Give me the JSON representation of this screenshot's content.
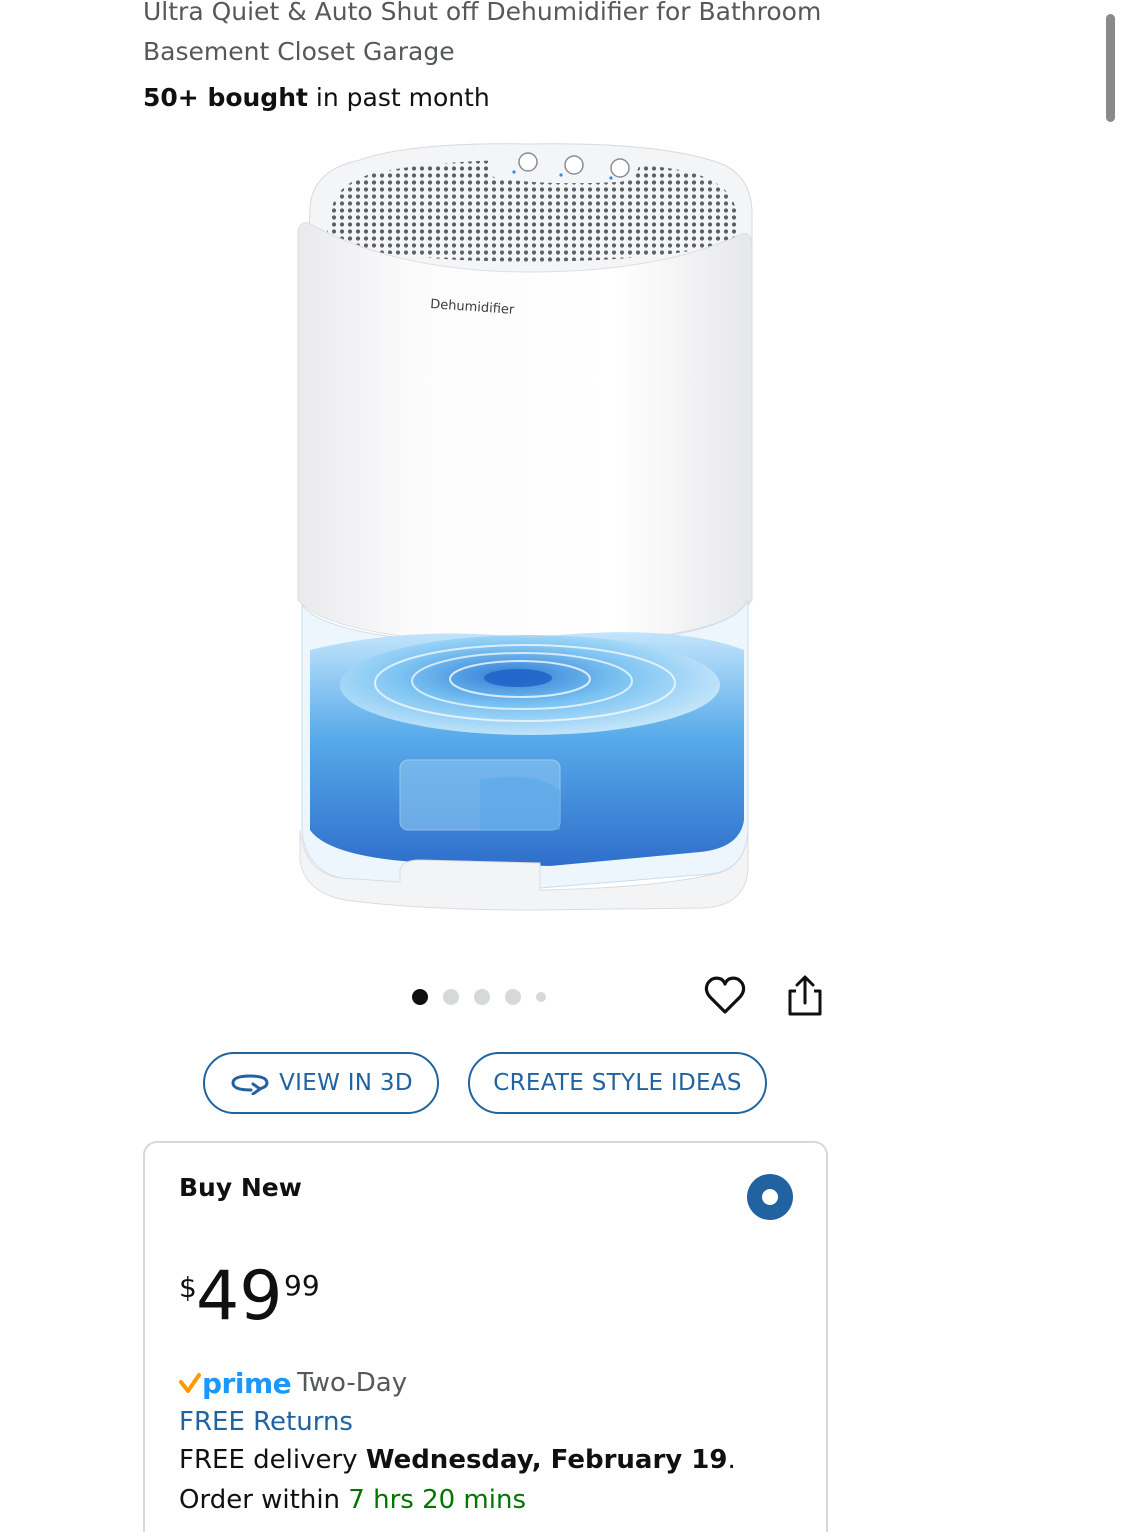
{
  "product": {
    "title": "Ultra Quiet & Auto Shut off Dehumidifier for Bathroom Basement Closet Garage",
    "bought_bold": "50+ bought",
    "bought_rest": " in past month",
    "image_label": "Dehumidifier"
  },
  "gallery": {
    "total_images": 5,
    "active_index": 0
  },
  "actions": {
    "wishlist_icon": "heart-icon",
    "share_icon": "share-icon"
  },
  "buttons": {
    "view_3d": "VIEW IN 3D",
    "create_style_ideas": "CREATE STYLE IDEAS"
  },
  "buy_box": {
    "title": "Buy New",
    "price_symbol": "$",
    "price_whole": "49",
    "price_fraction": "99",
    "prime_label": "prime",
    "prime_speed": "Two-Day",
    "free_returns": "FREE Returns",
    "delivery_prefix": "FREE delivery ",
    "delivery_date": "Wednesday, February 19",
    "delivery_suffix": ".",
    "order_prefix": "Order within ",
    "order_countdown": "7 hrs 20 mins"
  },
  "colors": {
    "link_blue": "#2162a1",
    "prime_blue": "#1a98ff",
    "prime_check_orange": "#ff9900",
    "countdown_green": "#007600",
    "text_primary": "#0f1111",
    "text_secondary": "#565959"
  }
}
